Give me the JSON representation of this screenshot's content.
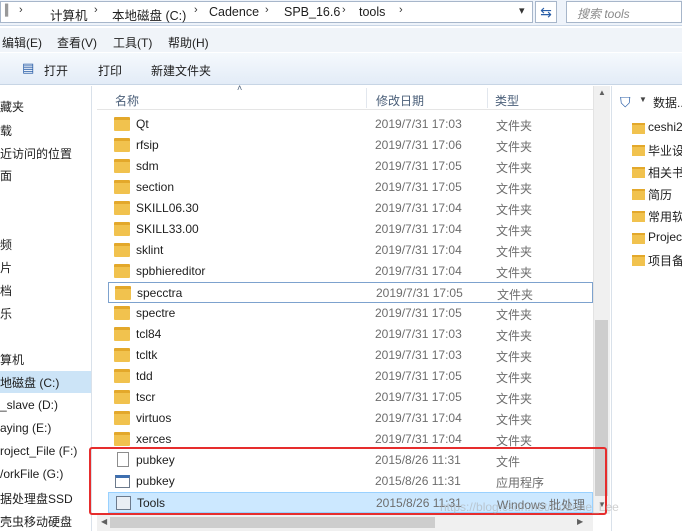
{
  "breadcrumb": [
    "计算机",
    "本地磁盘 (C:)",
    "Cadence",
    "SPB_16.6",
    "tools"
  ],
  "search_placeholder": "搜索 tools",
  "menu": [
    "编辑(E)",
    "查看(V)",
    "工具(T)",
    "帮助(H)"
  ],
  "toolbar": {
    "open": "打开",
    "print": "打印",
    "new_folder": "新建文件夹"
  },
  "nav_items": [
    "藏夹",
    "载",
    "近访问的位置",
    "面",
    "频",
    "片",
    "档",
    "乐",
    "算机",
    "地磁盘 (C:)",
    "_slave (D:)",
    "aying (E:)",
    "roject_File (F:)",
    "/orkFile (G:)",
    "据处理盘SSD",
    "壳虫移动硬盘"
  ],
  "columns": {
    "name": "名称",
    "date": "修改日期",
    "type": "类型"
  },
  "files": [
    {
      "name": "Qt",
      "date": "2019/7/31 17:03",
      "type": "文件夹",
      "icon": "folder-icon"
    },
    {
      "name": "rfsip",
      "date": "2019/7/31 17:06",
      "type": "文件夹",
      "icon": "folder-icon"
    },
    {
      "name": "sdm",
      "date": "2019/7/31 17:05",
      "type": "文件夹",
      "icon": "folder-icon"
    },
    {
      "name": "section",
      "date": "2019/7/31 17:05",
      "type": "文件夹",
      "icon": "folder-icon"
    },
    {
      "name": "SKILL06.30",
      "date": "2019/7/31 17:04",
      "type": "文件夹",
      "icon": "folder-icon"
    },
    {
      "name": "SKILL33.00",
      "date": "2019/7/31 17:04",
      "type": "文件夹",
      "icon": "folder-icon"
    },
    {
      "name": "sklint",
      "date": "2019/7/31 17:04",
      "type": "文件夹",
      "icon": "folder-icon"
    },
    {
      "name": "spbhiereditor",
      "date": "2019/7/31 17:04",
      "type": "文件夹",
      "icon": "folder-icon"
    },
    {
      "name": "specctra",
      "date": "2019/7/31 17:05",
      "type": "文件夹",
      "icon": "folder-icon"
    },
    {
      "name": "spectre",
      "date": "2019/7/31 17:05",
      "type": "文件夹",
      "icon": "folder-icon"
    },
    {
      "name": "tcl84",
      "date": "2019/7/31 17:03",
      "type": "文件夹",
      "icon": "folder-icon"
    },
    {
      "name": "tcltk",
      "date": "2019/7/31 17:03",
      "type": "文件夹",
      "icon": "folder-icon"
    },
    {
      "name": "tdd",
      "date": "2019/7/31 17:05",
      "type": "文件夹",
      "icon": "folder-icon"
    },
    {
      "name": "tscr",
      "date": "2019/7/31 17:05",
      "type": "文件夹",
      "icon": "folder-icon"
    },
    {
      "name": "virtuos",
      "date": "2019/7/31 17:04",
      "type": "文件夹",
      "icon": "folder-icon"
    },
    {
      "name": "xerces",
      "date": "2019/7/31 17:04",
      "type": "文件夹",
      "icon": "folder-icon"
    },
    {
      "name": "pubkey",
      "date": "2015/8/26 11:31",
      "type": "文件",
      "icon": "file-icon"
    },
    {
      "name": "pubkey",
      "date": "2015/8/26 11:31",
      "type": "应用程序",
      "icon": "exe-icon"
    },
    {
      "name": "Tools",
      "date": "2015/8/26 11:31",
      "type": "Windows 批处理",
      "icon": "batch-icon"
    }
  ],
  "right_header": "数据...",
  "right_items": [
    "ceshi2",
    "毕业设",
    "相关书",
    "简历",
    "常用软",
    "Projec",
    "项目备"
  ],
  "watermark": "https://blog.csdn.net/Kodone_Lee"
}
